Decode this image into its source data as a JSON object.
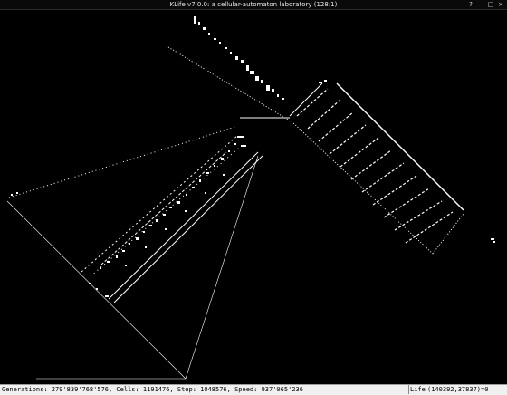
{
  "window": {
    "title": "KLife v7.0.0: a cellular-automaton laboratory (128:1)",
    "controls": {
      "help": "?",
      "minimize": "–",
      "maximize": "□",
      "close": "×"
    }
  },
  "statusbar": {
    "generation_text": "Generations: 279'839'768'576, Cells: 1191476, Step: 1048576, Speed: 937'065'236",
    "rule": "Life",
    "coordinates": "(140392,37837)=0"
  },
  "colors": {
    "background": "#000000",
    "cells": "#ffffff",
    "statusbar": "#f0f0f0"
  }
}
